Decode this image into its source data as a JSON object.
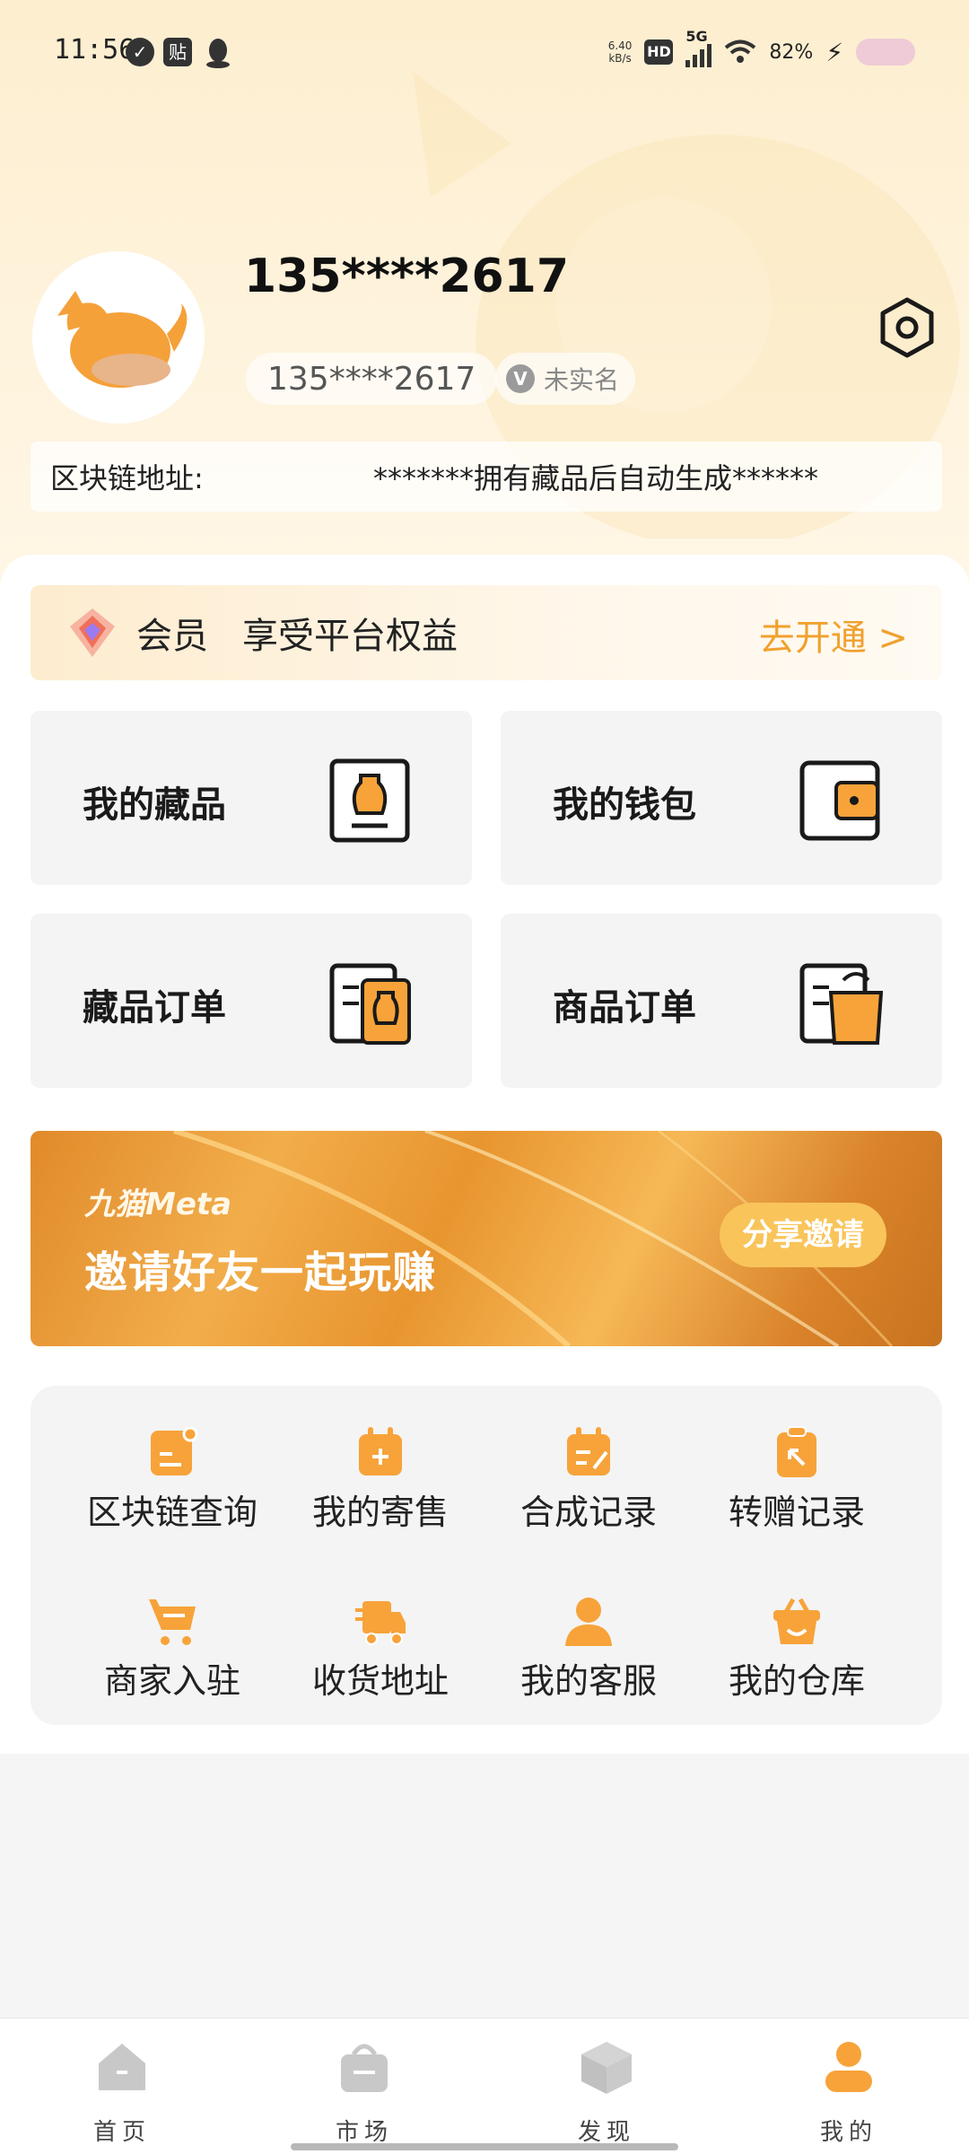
{
  "status_bar": {
    "time": "11:56",
    "notification_icons": [
      "check-circle-icon",
      "paste-icon",
      "penguin-icon"
    ],
    "paste_badge": "贴",
    "net_speed_value": "6.40",
    "net_speed_unit": "kB/s",
    "hd": "HD",
    "network": "5G",
    "battery": "82%"
  },
  "profile": {
    "username": "135****2617",
    "phone": "135****2617",
    "verify_badge": "V",
    "verify_status": "未实名",
    "chain_label": "区块链地址:",
    "chain_value": "*******拥有藏品后自动生成******"
  },
  "vip": {
    "title": "会员",
    "desc": "享受平台权益",
    "cta": "去开通 >"
  },
  "tiles": [
    {
      "label": "我的藏品",
      "icon": "vase-icon"
    },
    {
      "label": "我的钱包",
      "icon": "wallet-icon"
    },
    {
      "label": "藏品订单",
      "icon": "collection-order-icon"
    },
    {
      "label": "商品订单",
      "icon": "shopping-bag-order-icon"
    }
  ],
  "banner": {
    "brand": "九猫Meta",
    "title": "邀请好友一起玩赚",
    "button": "分享邀请"
  },
  "tools": [
    {
      "label": "区块链查询",
      "icon": "blockchain-query-icon"
    },
    {
      "label": "我的寄售",
      "icon": "consignment-icon"
    },
    {
      "label": "合成记录",
      "icon": "synthesis-record-icon"
    },
    {
      "label": "转赠记录",
      "icon": "transfer-record-icon"
    },
    {
      "label": "商家入驻",
      "icon": "cart-icon"
    },
    {
      "label": "收货地址",
      "icon": "delivery-truck-icon"
    },
    {
      "label": "我的客服",
      "icon": "customer-service-icon"
    },
    {
      "label": "我的仓库",
      "icon": "warehouse-basket-icon"
    }
  ],
  "nav": [
    {
      "label": "首页",
      "icon": "home-icon",
      "active": false
    },
    {
      "label": "市场",
      "icon": "market-bag-icon",
      "active": false
    },
    {
      "label": "发现",
      "icon": "discover-cube-icon",
      "active": false
    },
    {
      "label": "我的",
      "icon": "profile-icon",
      "active": true
    }
  ],
  "colors": {
    "accent": "#F0A12E",
    "icon_orange": "#F7A33A",
    "nav_inactive": "#C8C8C8",
    "hero_bg": "#FDEECF"
  }
}
